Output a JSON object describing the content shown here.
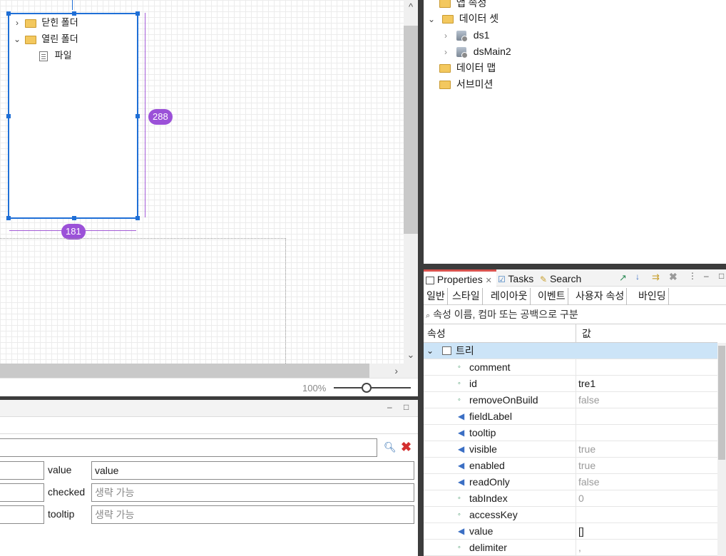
{
  "canvas": {
    "tree_items": [
      {
        "label": "닫힌 폴더",
        "state": "collapsed"
      },
      {
        "label": "열린 폴더",
        "state": "expanded"
      },
      {
        "label": "파일",
        "state": "leaf"
      }
    ],
    "height_value": "288",
    "width_value": "181",
    "zoom": "100%"
  },
  "scroll": {
    "up": "^",
    "down": "⌄",
    "right": "›"
  },
  "window_controls": {
    "minimize": "–",
    "maximize": "□"
  },
  "bottom_panel": {
    "fields": [
      {
        "label": "value",
        "value": "value",
        "placeholder": ""
      },
      {
        "label": "checked",
        "value": "",
        "placeholder": "생략 가능"
      },
      {
        "label": "tooltip",
        "value": "",
        "placeholder": "생략 가능"
      }
    ]
  },
  "outline": {
    "items": [
      {
        "label": "앱 속성",
        "kind": "folder"
      },
      {
        "label": "데이터 셋",
        "kind": "folder-open"
      },
      {
        "label": "ds1",
        "kind": "dataset"
      },
      {
        "label": "dsMain2",
        "kind": "dataset"
      },
      {
        "label": "데이터 맵",
        "kind": "folder"
      },
      {
        "label": "서브미션",
        "kind": "folder"
      }
    ]
  },
  "properties": {
    "tabs": [
      "Properties",
      "Tasks",
      "Search"
    ],
    "active_tab": "Properties",
    "categories": [
      "일반",
      "스타일",
      "레이아웃",
      "이벤트",
      "사용자 속성",
      "바인딩"
    ],
    "search_placeholder": "속성 이름, 컴마 또는 공백으로 구분",
    "col_name": "속성",
    "col_value": "값",
    "group": "트리",
    "rows": [
      {
        "name": "comment",
        "value": "",
        "muted": false,
        "mark": "dot"
      },
      {
        "name": "id",
        "value": "tre1",
        "muted": false,
        "mark": "dot"
      },
      {
        "name": "removeOnBuild",
        "value": "false",
        "muted": true,
        "mark": "dot"
      },
      {
        "name": "fieldLabel",
        "value": "",
        "muted": false,
        "mark": "speaker"
      },
      {
        "name": "tooltip",
        "value": "",
        "muted": false,
        "mark": "speaker"
      },
      {
        "name": "visible",
        "value": "true",
        "muted": true,
        "mark": "speaker"
      },
      {
        "name": "enabled",
        "value": "true",
        "muted": true,
        "mark": "speaker"
      },
      {
        "name": "readOnly",
        "value": "false",
        "muted": true,
        "mark": "speaker"
      },
      {
        "name": "tabIndex",
        "value": "0",
        "muted": true,
        "mark": "dot"
      },
      {
        "name": "accessKey",
        "value": "",
        "muted": false,
        "mark": "dot"
      },
      {
        "name": "value",
        "value": "[]",
        "muted": false,
        "mark": "speaker"
      },
      {
        "name": "delimiter",
        "value": ",",
        "muted": true,
        "mark": "dot"
      }
    ]
  },
  "colors": {
    "selection": "#1f6fd6",
    "dimension": "#9b51d8",
    "active_tab": "#d9534f",
    "group_row": "#cce4f7"
  }
}
